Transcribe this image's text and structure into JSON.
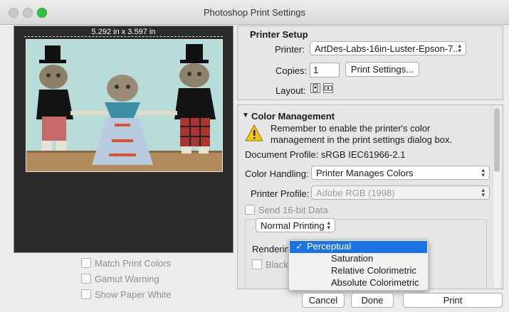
{
  "window": {
    "title": "Photoshop Print Settings"
  },
  "preview": {
    "dimensions": "5.292 in x 3.597 in"
  },
  "left_options": {
    "match_print_colors": "Match Print Colors",
    "gamut_warning": "Gamut Warning",
    "show_paper_white": "Show Paper White"
  },
  "printer_setup": {
    "heading": "Printer Setup",
    "printer_label": "Printer:",
    "printer_value": "ArtDes-Labs-16in-Luster-Epson-7...",
    "copies_label": "Copies:",
    "copies_value": "1",
    "print_settings_button": "Print Settings...",
    "layout_label": "Layout:"
  },
  "color_management": {
    "heading": "Color Management",
    "warning_line1": "Remember to enable the printer's color",
    "warning_line2": "management in the print settings dialog box.",
    "document_profile": "Document Profile: sRGB IEC61966-2.1",
    "color_handling_label": "Color Handling:",
    "color_handling_value": "Printer Manages Colors",
    "printer_profile_label": "Printer Profile:",
    "printer_profile_value": "Adobe RGB (1998)",
    "send_16bit": "Send 16-bit Data",
    "normal_printing": "Normal Printing",
    "rendering_intent_label": "Rendering Intent:",
    "black_point": "Black Point Co"
  },
  "rendering_menu": {
    "items": [
      "Perceptual",
      "Saturation",
      "Relative Colorimetric",
      "Absolute Colorimetric"
    ],
    "selected_check": "✓"
  },
  "buttons": {
    "cancel": "Cancel",
    "done": "Done",
    "print": "Print"
  },
  "icons": {
    "warning": "warning-triangle-icon",
    "disclosure": "disclosure-triangle-icon"
  }
}
